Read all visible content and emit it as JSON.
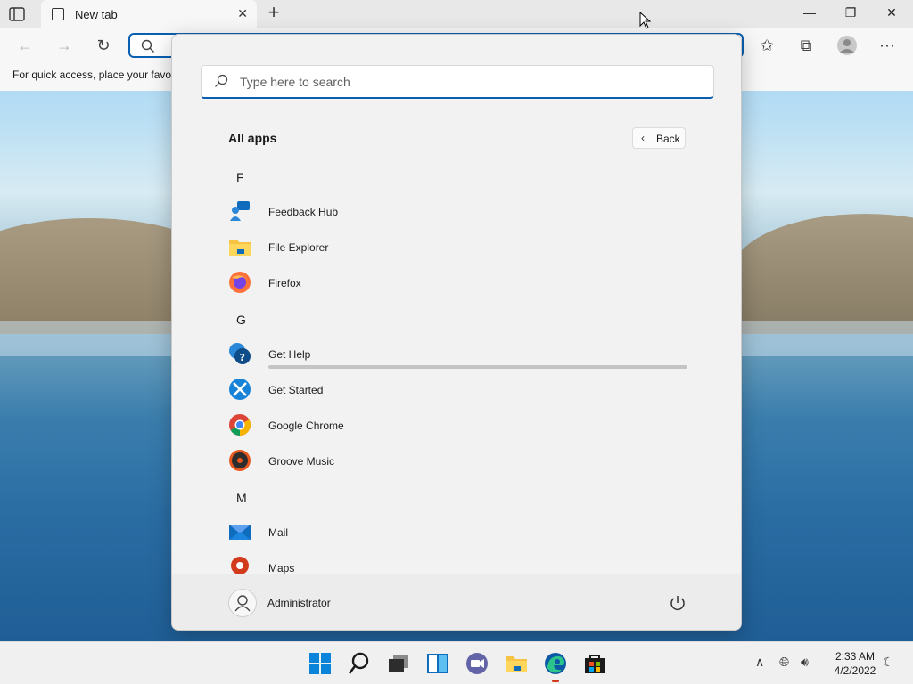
{
  "browser": {
    "tab_title": "New tab",
    "favorites_hint": "For quick access, place your favo"
  },
  "start_menu": {
    "search_placeholder": "Type here to search",
    "all_apps_title": "All apps",
    "back_label": "Back",
    "sections": [
      {
        "letter": "F",
        "apps": [
          "Feedback Hub",
          "File Explorer",
          "Firefox"
        ]
      },
      {
        "letter": "G",
        "apps": [
          "Get Help",
          "Get Started",
          "Google Chrome",
          "Groove Music"
        ]
      },
      {
        "letter": "M",
        "apps": [
          "Mail",
          "Maps"
        ]
      }
    ],
    "user_name": "Administrator"
  },
  "taskbar": {
    "time": "2:33 AM",
    "date": "4/2/2022"
  },
  "colors": {
    "accent": "#0a5fb0",
    "menu_bg": "#f2f2f2",
    "taskbar_bg": "#f0f0f0"
  },
  "icons": [
    "sidebar-tabs-icon",
    "new-tab-page-icon",
    "close-icon",
    "plus-icon",
    "minimize-icon",
    "restore-icon",
    "back-arrow-icon",
    "forward-arrow-icon",
    "refresh-icon",
    "search-icon",
    "favorites-icon",
    "collections-icon",
    "profile-icon",
    "more-icon",
    "feedback-hub-icon",
    "file-explorer-icon",
    "firefox-icon",
    "get-help-icon",
    "get-started-icon",
    "chrome-icon",
    "groove-music-icon",
    "mail-icon",
    "maps-icon",
    "user-icon",
    "power-icon",
    "windows-start-icon",
    "taskbar-search-icon",
    "task-view-icon",
    "widgets-icon",
    "teams-chat-icon",
    "edge-icon",
    "store-icon",
    "chevron-up-icon",
    "network-icon",
    "volume-icon",
    "focus-assist-icon"
  ]
}
